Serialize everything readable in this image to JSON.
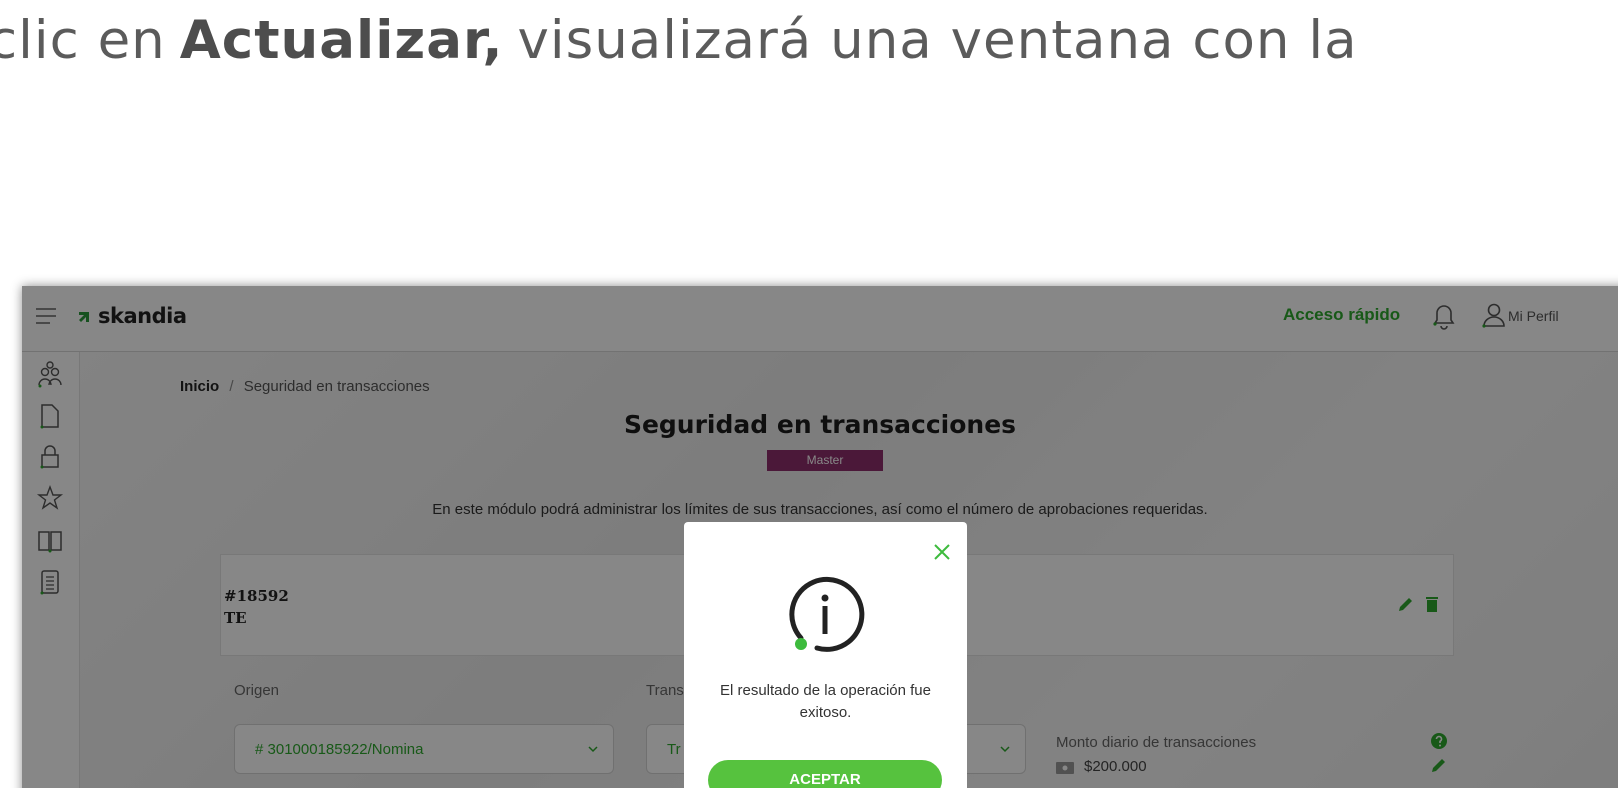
{
  "caption": {
    "before": "clic en",
    "bold": "Actualizar,",
    "after": "visualizará una ventana con la"
  },
  "app": {
    "brand": "skandia",
    "quick_access": "Acceso rápido",
    "profile_label": "Mi Perfil",
    "colors": {
      "accent": "#2fa82f",
      "brand_mark": "#2b9a3b",
      "badge": "#8e2e6c",
      "button": "#56c23e"
    }
  },
  "sidebar": {
    "icons": [
      "users-icon",
      "document-icon",
      "lock-icon",
      "star-icon",
      "book-icon",
      "list-icon"
    ]
  },
  "breadcrumb": {
    "home": "Inicio",
    "separator": "/",
    "current": "Seguridad en transacciones"
  },
  "page": {
    "title": "Seguridad en transacciones",
    "badge": "Master",
    "intro": "En este módulo podrá administrar los límites de sus transacciones, así como el número de aprobaciones requeridas."
  },
  "card": {
    "id": "#18592",
    "code": "TE"
  },
  "form": {
    "origin_label": "Origen",
    "origin_value": "# 301000185922/Nomina",
    "type_label": "Trans",
    "type_value": "Tr",
    "daily_limit_label": "Monto diario de transacciones",
    "daily_limit_value": "$200.000"
  },
  "modal": {
    "message": "El resultado de la operación fue exitoso.",
    "accept_label": "ACEPTAR"
  }
}
